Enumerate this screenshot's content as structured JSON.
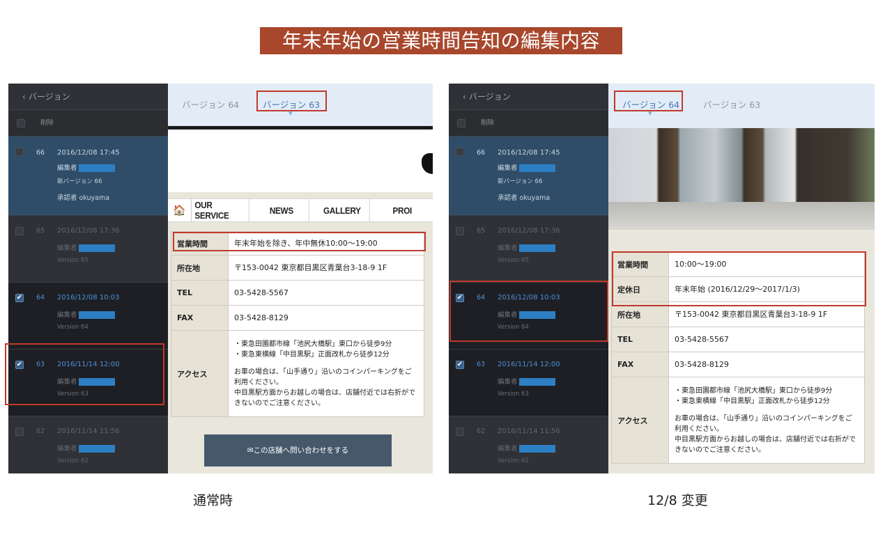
{
  "title": "年末年始の営業時間告知の編集内容",
  "panels": [
    {
      "caption": "通常時",
      "sidebar": {
        "header": "バージョン",
        "delete_label": "削除",
        "versions": [
          {
            "num": "66",
            "date": "2016/12/08 17:45",
            "editor_label": "編集者",
            "note": "新バージョン 66",
            "approver": "承認者 okuyama",
            "checked": false
          },
          {
            "num": "65",
            "date": "2016/12/08 17:36",
            "editor_label": "編集者",
            "note": "Version 65",
            "checked": false
          },
          {
            "num": "64",
            "date": "2016/12/08 10:03",
            "editor_label": "編集者",
            "note": "Version 64",
            "checked": true
          },
          {
            "num": "63",
            "date": "2016/11/14 12:00",
            "editor_label": "編集者",
            "note": "Version 63",
            "checked": true
          },
          {
            "num": "62",
            "date": "2016/11/14 11:56",
            "editor_label": "編集者",
            "note": "Version 62",
            "checked": false
          }
        ],
        "check_glyph": "✔"
      },
      "tabs": [
        "バージョン 64",
        "バージョン 63"
      ],
      "selected_tab": 1,
      "nav": {
        "home_icon": "home-icon",
        "items": [
          "OUR SERVICE",
          "NEWS",
          "GALLERY",
          "PROI"
        ]
      },
      "info_rows": [
        {
          "key": "営業時間",
          "value": "年末年始を除き、年中無休10:00〜19:00"
        },
        {
          "key": "所在地",
          "value": "〒153-0042 東京都目黒区青葉台3-18-9 1F"
        },
        {
          "key": "TEL",
          "value": "03-5428-5567"
        },
        {
          "key": "FAX",
          "value": "03-5428-8129"
        },
        {
          "key": "アクセス",
          "lines": [
            "・東急田園都市線「池尻大橋駅」東口から徒歩9分",
            "・東急東横線「中目黒駅」正面改札から徒歩12分",
            "",
            "お車の場合は、「山手通り」沿いのコインパーキングをご",
            "利用ください。",
            "中目黒駅方面からお越しの場合は、店舗付近では右折がで",
            "きないのでご注意ください。"
          ]
        }
      ],
      "contact_button": "✉この店舗へ問い合わせをする"
    },
    {
      "caption": "12/8 変更",
      "sidebar": {
        "header": "バージョン",
        "delete_label": "削除",
        "versions": [
          {
            "num": "66",
            "date": "2016/12/08 17:45",
            "editor_label": "編集者",
            "note": "新バージョン 66",
            "approver": "承認者 okuyama",
            "checked": false
          },
          {
            "num": "65",
            "date": "2016/12/08 17:36",
            "editor_label": "編集者",
            "note": "Version 65",
            "checked": false
          },
          {
            "num": "64",
            "date": "2016/12/08 10:03",
            "editor_label": "編集者",
            "note": "Version 64",
            "checked": true
          },
          {
            "num": "63",
            "date": "2016/11/14 12:00",
            "editor_label": "編集者",
            "note": "Version 63",
            "checked": true
          },
          {
            "num": "62",
            "date": "2016/11/14 11:56",
            "editor_label": "編集者",
            "note": "Version 62",
            "checked": false
          }
        ],
        "check_glyph": "✔"
      },
      "tabs": [
        "バージョン 64",
        "バージョン 63"
      ],
      "selected_tab": 0,
      "info_rows": [
        {
          "key": "営業時間",
          "value": "10:00〜19:00"
        },
        {
          "key": "定休日",
          "value": "年末年始 (2016/12/29〜2017/1/3)"
        },
        {
          "key": "所在地",
          "value": "〒153-0042 東京都目黒区青葉台3-18-9 1F"
        },
        {
          "key": "TEL",
          "value": "03-5428-5567"
        },
        {
          "key": "FAX",
          "value": "03-5428-8129"
        },
        {
          "key": "アクセス",
          "lines": [
            "・東急田園都市線「池尻大橋駅」東口から徒歩9分",
            "・東急東横線「中目黒駅」正面改札から徒歩12分",
            "",
            "お車の場合は、「山手通り」沿いのコインパーキングをご",
            "利用ください。",
            "中目黒駅方面からお越しの場合は、店舗付近では右折がで",
            "きないのでご注意ください。"
          ]
        }
      ]
    }
  ],
  "colors": {
    "highlight": "#c0392b",
    "title_bg": "#a8472c",
    "sidebar": "#2f3136",
    "active_version": "#2f4d68",
    "tab_selected": "#3f77b7"
  }
}
